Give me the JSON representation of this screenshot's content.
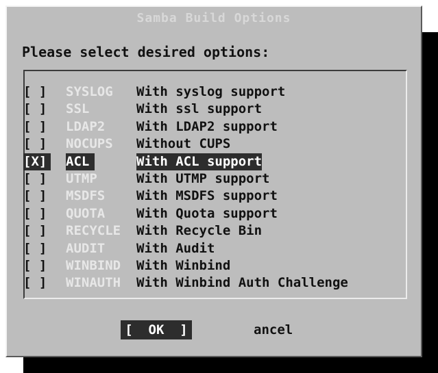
{
  "dialog": {
    "title": "Samba Build Options",
    "prompt": "Please select desired options:",
    "items": [
      {
        "check": "[ ]",
        "tag": "SYSLOG",
        "label": "With syslog support",
        "selected": false
      },
      {
        "check": "[ ]",
        "tag": "SSL",
        "label": "With ssl support",
        "selected": false
      },
      {
        "check": "[ ]",
        "tag": "LDAP2",
        "label": "With LDAP2 support",
        "selected": false
      },
      {
        "check": "[ ]",
        "tag": "NOCUPS",
        "label": "Without CUPS",
        "selected": false
      },
      {
        "check": "[X]",
        "tag": "ACL",
        "label": "With ACL support",
        "selected": true
      },
      {
        "check": "[ ]",
        "tag": "UTMP",
        "label": "With UTMP support",
        "selected": false
      },
      {
        "check": "[ ]",
        "tag": "MSDFS",
        "label": "With MSDFS support",
        "selected": false
      },
      {
        "check": "[ ]",
        "tag": "QUOTA",
        "label": "With Quota support",
        "selected": false
      },
      {
        "check": "[ ]",
        "tag": "RECYCLE",
        "label": "With Recycle Bin",
        "selected": false
      },
      {
        "check": "[ ]",
        "tag": "AUDIT",
        "label": "With Audit",
        "selected": false
      },
      {
        "check": "[ ]",
        "tag": "WINBIND",
        "label": "With Winbind",
        "selected": false
      },
      {
        "check": "[ ]",
        "tag": "WINAUTH",
        "label": "With Winbind Auth Challenge",
        "selected": false
      }
    ],
    "ok_label": "[  OK  ]",
    "cancel_label": "ancel"
  }
}
